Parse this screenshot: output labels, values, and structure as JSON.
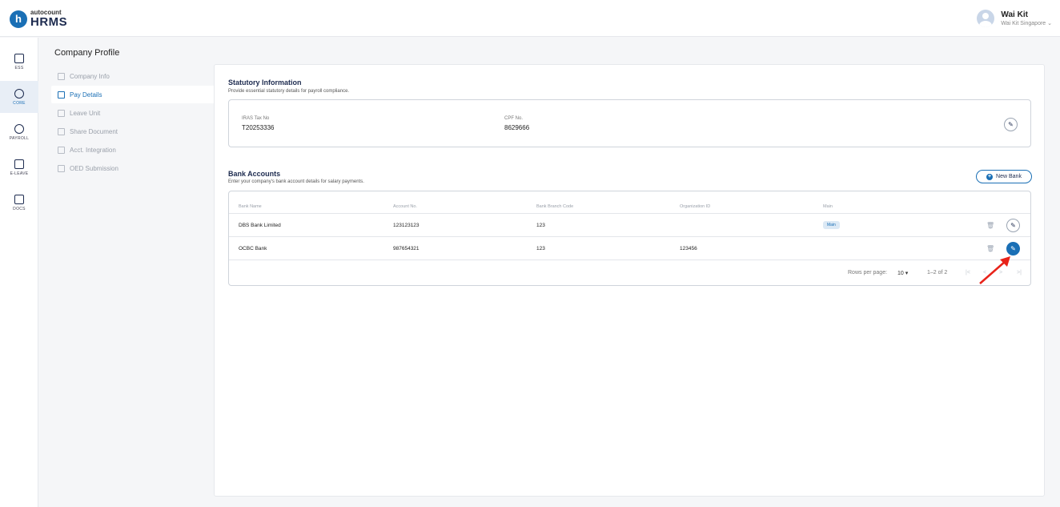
{
  "brand": {
    "badge": "h",
    "name": "autocount",
    "product": "HRMS"
  },
  "user": {
    "name": "Wai Kit",
    "company": "Wai Kit Singapore ⌄"
  },
  "rail": [
    {
      "label": "ESS",
      "icon": "calendar-card-icon",
      "active": false
    },
    {
      "label": "CORE",
      "icon": "cube-icon",
      "active": true
    },
    {
      "label": "PAYROLL",
      "icon": "dollar-icon",
      "active": false
    },
    {
      "label": "E-LEAVE",
      "icon": "calendar-icon",
      "active": false
    },
    {
      "label": "DOCS",
      "icon": "document-icon",
      "active": false
    }
  ],
  "subnav": {
    "title": "Company Profile",
    "items": [
      {
        "label": "Company Info",
        "active": false
      },
      {
        "label": "Pay Details",
        "active": true
      },
      {
        "label": "Leave Unit",
        "active": false
      },
      {
        "label": "Share Document",
        "active": false
      },
      {
        "label": "Acct. Integration",
        "active": false
      },
      {
        "label": "OED Submission",
        "active": false
      }
    ]
  },
  "statutory": {
    "title": "Statutory Information",
    "desc": "Provide essential statutory details for payroll compliance.",
    "iras_label": "IRAS Tax No",
    "iras_value": "T20253336",
    "cpf_label": "CPF No.",
    "cpf_value": "8629666"
  },
  "bank": {
    "title": "Bank Accounts",
    "desc": "Enter your company's bank account details for salary payments.",
    "new_label": "New Bank",
    "columns": [
      "Bank Name",
      "Account No.",
      "Bank Branch Code",
      "Organization ID",
      "Main"
    ],
    "rows": [
      {
        "name": "DBS Bank Limited",
        "account": "123123123",
        "branch": "123",
        "org": "",
        "main": "Main"
      },
      {
        "name": "OCBC Bank",
        "account": "987654321",
        "branch": "123",
        "org": "123456",
        "main": ""
      }
    ],
    "rows_per_page_label": "Rows per page:",
    "rows_per_page": "10 ▾",
    "range": "1–2 of 2"
  },
  "colors": {
    "accent": "#1a6fb5",
    "navy": "#1d2b4f",
    "arrow": "#e8231a"
  }
}
